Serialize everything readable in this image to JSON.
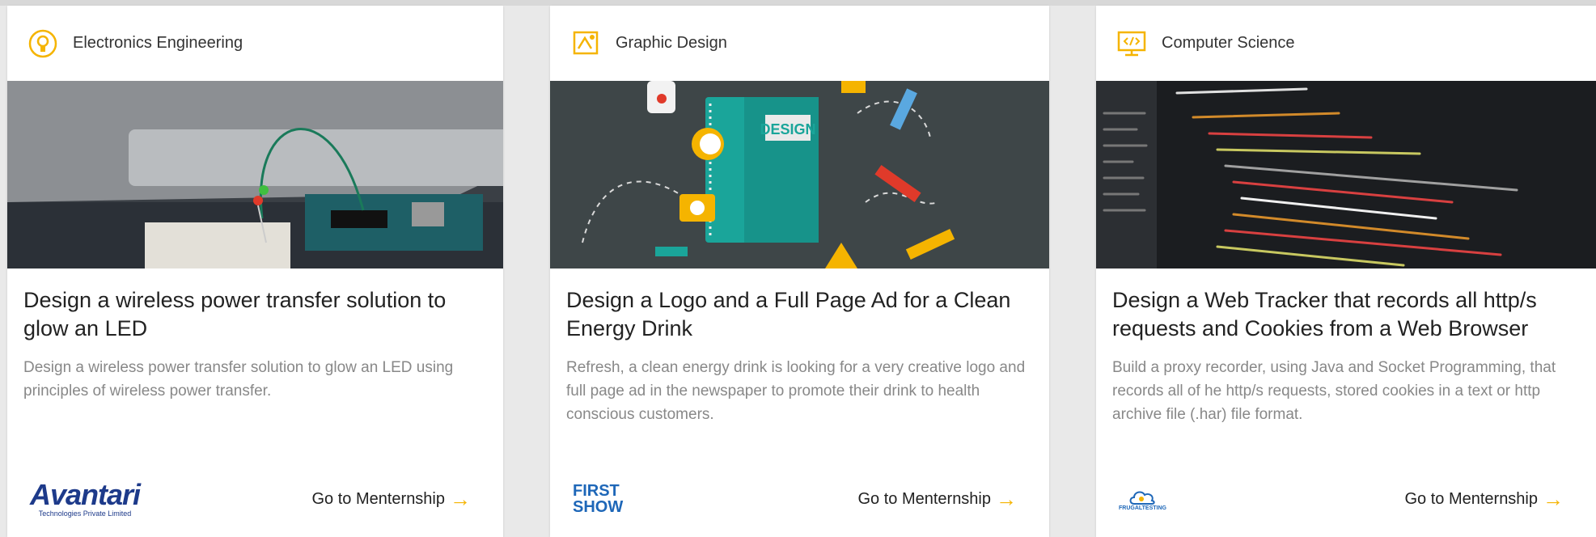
{
  "cards": [
    {
      "category": "Electronics Engineering",
      "category_icon": "lightbulb-circle-icon",
      "title": "Design a wireless power transfer solution to glow an LED",
      "description": " Design a wireless power transfer solution to glow an LED using principles of wireless power transfer.",
      "link": "Go to Menternship",
      "logo": {
        "name": "Avantari",
        "tagline": "Technologies Private Limited"
      }
    },
    {
      "category": "Graphic Design",
      "category_icon": "palette-design-icon",
      "title": "Design a Logo and a Full Page Ad for a Clean Energy Drink",
      "description": "Refresh, a clean energy drink is looking for a very creative logo and full page ad in the newspaper to promote their drink to health conscious customers.",
      "link": "Go to Menternship",
      "banner_word": "DESIGN",
      "logo": {
        "line1": "FIRST",
        "line2": "SHOW"
      }
    },
    {
      "category": "Computer Science",
      "category_icon": "monitor-code-icon",
      "title": "Design a Web Tracker that records all http/s requests and Cookies from a Web Browser",
      "description": "Build a proxy recorder, using Java and Socket Programming, that records all of he http/s requests, stored cookies in a text or http archive file (.har) file format.",
      "link": "Go to Menternship",
      "logo": {
        "name": "FRUGALTESTING"
      }
    }
  ],
  "colors": {
    "accent": "#f5b400",
    "text": "#222222",
    "muted": "#888888",
    "logo_blue": "#1d3a8a"
  }
}
